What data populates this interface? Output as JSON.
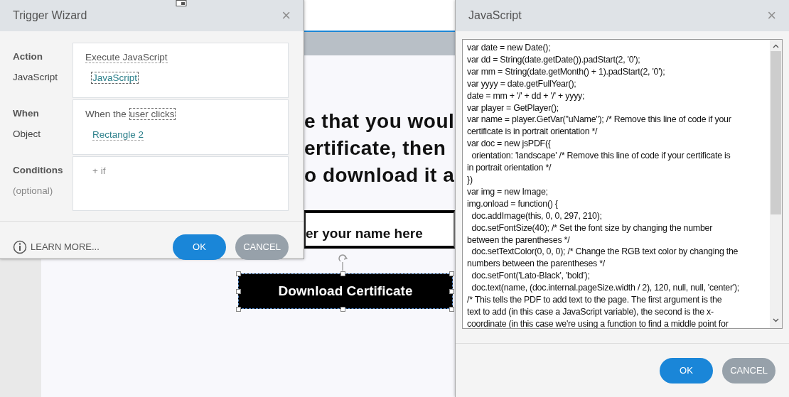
{
  "slide": {
    "text_lines": [
      "e that you woul",
      "ertificate, then",
      "o download it a"
    ],
    "name_field": {
      "placeholder": "er your name here"
    },
    "download_button": {
      "label": "Download Certificate",
      "selected": true
    }
  },
  "trigger_wizard": {
    "title": "Trigger Wizard",
    "close": "×",
    "sections": [
      {
        "rows": [
          {
            "label": "Action",
            "value": "Execute JavaScript",
            "kind": "dropdown"
          },
          {
            "label": "JavaScript",
            "value": "JavaScript",
            "kind": "link"
          }
        ]
      },
      {
        "rows": [
          {
            "label": "When",
            "prefix": "When the",
            "value": "user clicks",
            "kind": "dropdown"
          },
          {
            "label": "Object",
            "value": "Rectangle 2",
            "kind": "link"
          }
        ]
      },
      {
        "rows": [
          {
            "label": "Conditions",
            "sublabel": "(optional)",
            "value": "+ if",
            "kind": "add"
          }
        ]
      }
    ],
    "learn_more": "LEARN MORE...",
    "buttons": [
      {
        "label": "OK",
        "kind": "primary"
      },
      {
        "label": "CANCEL",
        "kind": "secondary"
      }
    ]
  },
  "javascript_dialog": {
    "title": "JavaScript",
    "close": "×",
    "code_lines": [
      "var date = new Date();",
      "var dd = String(date.getDate()).padStart(2, '0');",
      "var mm = String(date.getMonth() + 1).padStart(2, '0');",
      "var yyyy = date.getFullYear();",
      "date = mm + '/' + dd + '/' + yyyy;",
      "var player = GetPlayer();",
      "var name = player.GetVar(\"uName\"); /* Remove this line of code if your",
      "certificate is in portrait orientation */",
      "var doc = new jsPDF({",
      "  orientation: 'landscape' /* Remove this line of code if your certificate is",
      "in portrait orientation */",
      "})",
      "var img = new Image;",
      "img.onload = function() {",
      "  doc.addImage(this, 0, 0, 297, 210);",
      "  doc.setFontSize(40); /* Set the font size by changing the number",
      "between the parentheses */",
      "  doc.setTextColor(0, 0, 0); /* Change the RGB text color by changing the",
      "numbers between the parentheses */",
      "  doc.setFont('Lato-Black', 'bold');",
      "  doc.text(name, (doc.internal.pageSize.width / 2), 120, null, null, 'center');",
      "/* This tells the PDF to add text to the page. The first argument is the",
      "text to add (in this case a JavaScript variable), the second is the x-",
      "coordinate (in this case we're using a function to find a middle point for"
    ],
    "buttons": [
      {
        "label": "OK",
        "kind": "primary"
      },
      {
        "label": "CANCEL",
        "kind": "secondary"
      }
    ]
  }
}
